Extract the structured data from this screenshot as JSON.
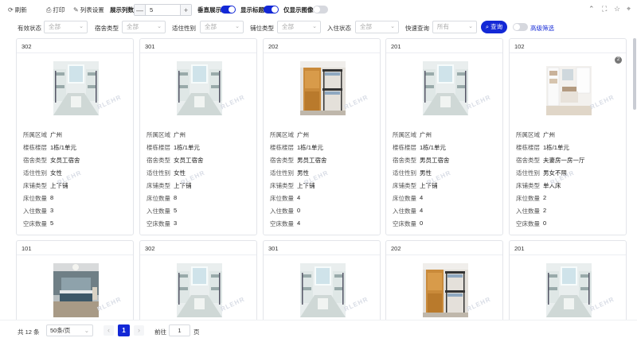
{
  "toolbar": {
    "refresh": "刷新",
    "print": "打印",
    "list_settings": "列表设置",
    "columns_label": "展示列数",
    "columns_value": "5",
    "stepper_minus": "—",
    "stepper_plus": "+",
    "vertical_label": "垂直展示",
    "vertical_on": true,
    "show_title_label": "显示标题",
    "show_title_on": true,
    "only_image_label": "仅显示图像",
    "only_image_on": false
  },
  "filters": {
    "status_label": "有效状态",
    "dorm_type_label": "宿舍类型",
    "gender_label": "适住性别",
    "bed_type_label": "铺位类型",
    "occupancy_label": "入住状态",
    "quick_label": "快速查询",
    "all": "全部",
    "quick_value": "所有",
    "query_button": "查询",
    "advanced_label": "高级筛选"
  },
  "field_labels": {
    "region": "所属区域",
    "floor": "楼栋楼层",
    "dorm_type": "宿舍类型",
    "gender": "适住性别",
    "bed_type": "床铺类型",
    "beds": "床位数量",
    "occupied": "入住数量",
    "empty": "空床数量"
  },
  "watermark": "RLEHR",
  "cards": [
    {
      "title": "302",
      "photo": "dorm-white",
      "region": "广州",
      "floor": "1栋/1单元",
      "dorm_type": "女员工宿舍",
      "gender": "女性",
      "bed_type": "上下铺",
      "beds": "8",
      "occupied": "3",
      "empty": "5"
    },
    {
      "title": "301",
      "photo": "dorm-white",
      "region": "广州",
      "floor": "1栋/1单元",
      "dorm_type": "女员工宿舍",
      "gender": "女性",
      "bed_type": "上下铺",
      "beds": "8",
      "occupied": "5",
      "empty": "3"
    },
    {
      "title": "202",
      "photo": "dorm-wood",
      "region": "广州",
      "floor": "1栋/1单元",
      "dorm_type": "男员工宿舍",
      "gender": "男性",
      "bed_type": "上下铺",
      "beds": "4",
      "occupied": "0",
      "empty": "4"
    },
    {
      "title": "201",
      "photo": "dorm-white",
      "region": "广州",
      "floor": "1栋/1单元",
      "dorm_type": "男员工宿舍",
      "gender": "男性",
      "bed_type": "上下铺",
      "beds": "4",
      "occupied": "4",
      "empty": "0"
    },
    {
      "title": "102",
      "photo": "apartment",
      "badge": "2",
      "region": "广州",
      "floor": "1栋/1单元",
      "dorm_type": "夫妻房一房一厅",
      "gender": "男女不限",
      "bed_type": "单人床",
      "beds": "2",
      "occupied": "2",
      "empty": "0"
    },
    {
      "title": "101",
      "photo": "bedroom"
    },
    {
      "title": "302",
      "photo": "dorm-white"
    },
    {
      "title": "301",
      "photo": "dorm-white"
    },
    {
      "title": "202",
      "photo": "dorm-wood"
    },
    {
      "title": "201",
      "photo": "dorm-white"
    }
  ],
  "pager": {
    "total": "共 12 条",
    "page_size": "50条/页",
    "current_page": "1",
    "goto_label": "前往",
    "goto_value": "1",
    "page_suffix": "页"
  },
  "colors": {
    "accent": "#1328d6"
  }
}
